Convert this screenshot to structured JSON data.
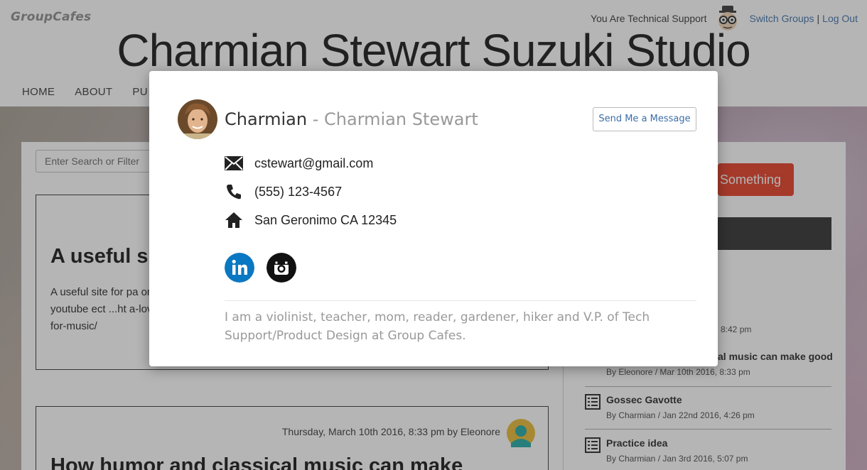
{
  "header": {
    "brand": "GroupCafes",
    "role_text": "You Are Technical Support",
    "switch_groups": "Switch Groups",
    "separator": "|",
    "log_out": "Log Out",
    "site_title": "Charmian Stewart Suzuki Studio"
  },
  "nav": {
    "items": [
      "HOME",
      "ABOUT",
      "PU"
    ]
  },
  "search": {
    "placeholder": "Enter Search or Filter"
  },
  "posts": [
    {
      "title": "A useful s",
      "body": "A useful site for pa on youtube ect ...ht a-love-for-music/"
    },
    {
      "meta": "Thursday, March 10th 2016, 8:33 pm by Eleonore",
      "title": "How humor and classical music can make"
    }
  ],
  "sidebar": {
    "cta_label": "Something",
    "items": [
      {
        "title": "s",
        "meta": "8:42 pm"
      },
      {
        "title": "al music can make good",
        "meta": "By Eleonore / Mar 10th 2016, 8:33 pm"
      },
      {
        "title": "Gossec Gavotte",
        "meta": "By Charmian / Jan 22nd 2016, 4:26 pm"
      },
      {
        "title": "Practice idea",
        "meta": "By Charmian / Jan 3rd 2016, 5:07 pm"
      }
    ]
  },
  "modal": {
    "nickname": "Charmian",
    "name_sep": " - ",
    "full_name": "Charmian Stewart",
    "message_button": "Send Me a Message",
    "email": "cstewart@gmail.com",
    "phone": "(555) 123-4567",
    "address": "San Geronimo CA 12345",
    "social": [
      "linkedin-icon",
      "instagram-icon"
    ],
    "bio": "I am a violinist, teacher, mom, reader, gardener, hiker and V.P. of Tech Support/Product Design at Group Cafes."
  },
  "colors": {
    "link": "#3b6ea8",
    "cta": "#e5371f",
    "linkedin": "#0a77c2",
    "overlay": "rgba(60,60,60,0.38)"
  }
}
